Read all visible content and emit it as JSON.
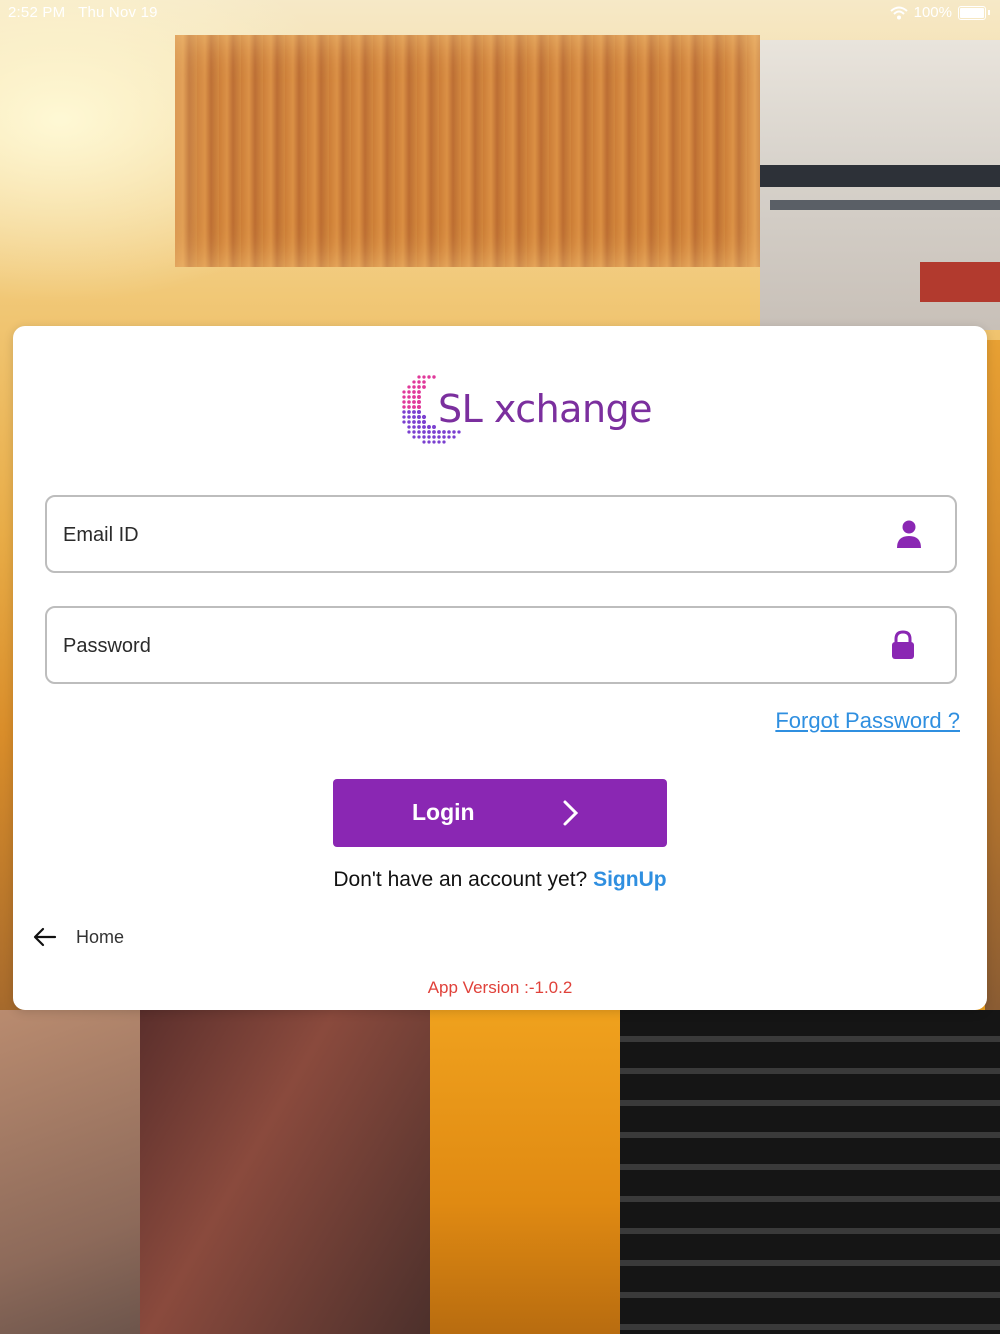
{
  "status_bar": {
    "time": "2:52 PM",
    "date": "Thu Nov 19",
    "battery": "100%"
  },
  "logo": {
    "brand": "SL xchange",
    "colors": {
      "brand_purple": "#7b2f9e",
      "dot_pink": "#e0399a",
      "dot_purple": "#7a3fd0"
    }
  },
  "form": {
    "email": {
      "placeholder": "Email ID",
      "value": "",
      "icon": "person-icon"
    },
    "password": {
      "placeholder": "Password",
      "value": "",
      "icon": "lock-icon"
    },
    "forgot_label": "Forgot Password ?",
    "login_label": "Login",
    "signup_prompt": "Don't have an account yet?",
    "signup_label": "SignUp"
  },
  "nav": {
    "home_label": "Home"
  },
  "footer": {
    "version": "App Version :-1.0.2"
  },
  "colors": {
    "accent": "#8a27b3",
    "link": "#2f8fe0",
    "version_text": "#e0413a"
  }
}
